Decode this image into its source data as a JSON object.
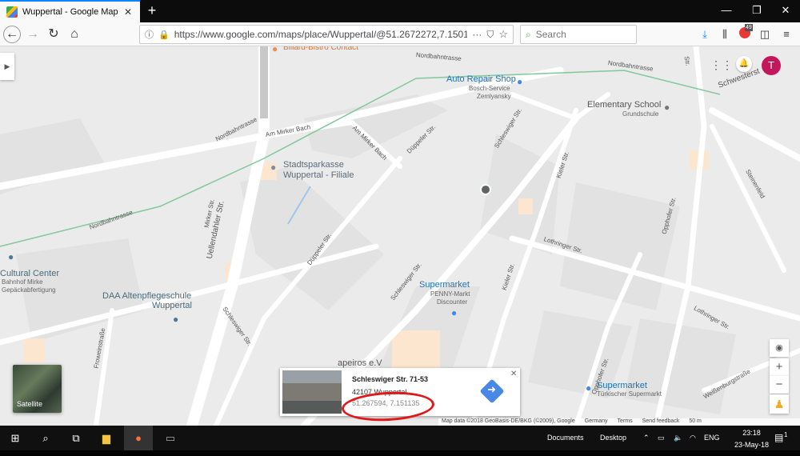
{
  "browser": {
    "tab_title": "Wuppertal - Google Maps",
    "new_tab": "+",
    "url": "https://www.google.com/maps/place/Wuppertal/@51.2672272,7.1501",
    "search_placeholder": "Search",
    "notification_badge": "49"
  },
  "map": {
    "avatar_initial": "T",
    "streets": {
      "nordbahn1": "Nordbahntrasse",
      "nordbahn2": "Nordbahntrasse",
      "nordbahn3": "Nordbahntrasse",
      "nordbahn4": "Nordbahntrasse",
      "am_mirker_bach1": "Am Mirker Bach",
      "am_mirker_bach2": "Am Mirker Bach",
      "duppeler1": "Düppeler Str.",
      "duppeler2": "Düppeler Str.",
      "schleswiger1": "Schleswiger Str.",
      "schleswiger2": "Schleswiger Str.",
      "schleswiger3": "Schleswiger Str.",
      "kieler1": "Kieler Str.",
      "kieler2": "Kieler Str.",
      "lothringer1": "Lothringer Str.",
      "lothringer2": "Lothringer Str.",
      "uellendahler": "Uellendahler Str.",
      "mirker": "Mirker Str.",
      "froweinstrasse": "Froweinstraße",
      "opphofer1": "Opphofer Str.",
      "opphofer2": "Opphofer Str.",
      "steinerfeld": "Steinenfeld",
      "schwesterstr": "Schwesterst",
      "weissenburg": "Weißenburgstraße",
      "str_top": "Str."
    },
    "pois": {
      "billard": "Billard-Bistro Contact",
      "auto_repair": "Auto Repair Shop",
      "auto_repair_sub1": "Bosch-Service",
      "auto_repair_sub2": "Zemlyansky",
      "elementary": "Elementary School",
      "elementary_sub": "Grundschule",
      "sparkasse1": "Stadtsparkasse",
      "sparkasse2": "Wuppertal - Filiale",
      "cultural": "Cultural Center",
      "cultural_sub1": "Bahnhof Mirke",
      "cultural_sub2": "Gepäckabfertigung",
      "daa1": "DAA Altenpflegeschule",
      "daa2": "Wuppertal",
      "supermarket1": "Supermarket",
      "supermarket1_sub1": "PENNY-Markt",
      "supermarket1_sub2": "Discounter",
      "supermarket2": "Supermarket",
      "supermarket2_sub": "Türkischer Supermarkt",
      "apeiros": "apeiros e.V"
    },
    "satellite_label": "Satellite",
    "infocard": {
      "title": "Schleswiger Str. 71-53",
      "address": "42107 Wuppertal",
      "coords": "51.267594, 7.151135"
    },
    "attribution": {
      "data": "Map data ©2018 GeoBasis-DE/BKG (©2009), Google",
      "country": "Germany",
      "terms": "Terms",
      "feedback": "Send feedback",
      "scale": "50 m"
    }
  },
  "taskbar": {
    "documents": "Documents",
    "desktop": "Desktop",
    "language": "ENG",
    "time": "23:18",
    "date": "23-May-18",
    "notif_count": "1"
  }
}
